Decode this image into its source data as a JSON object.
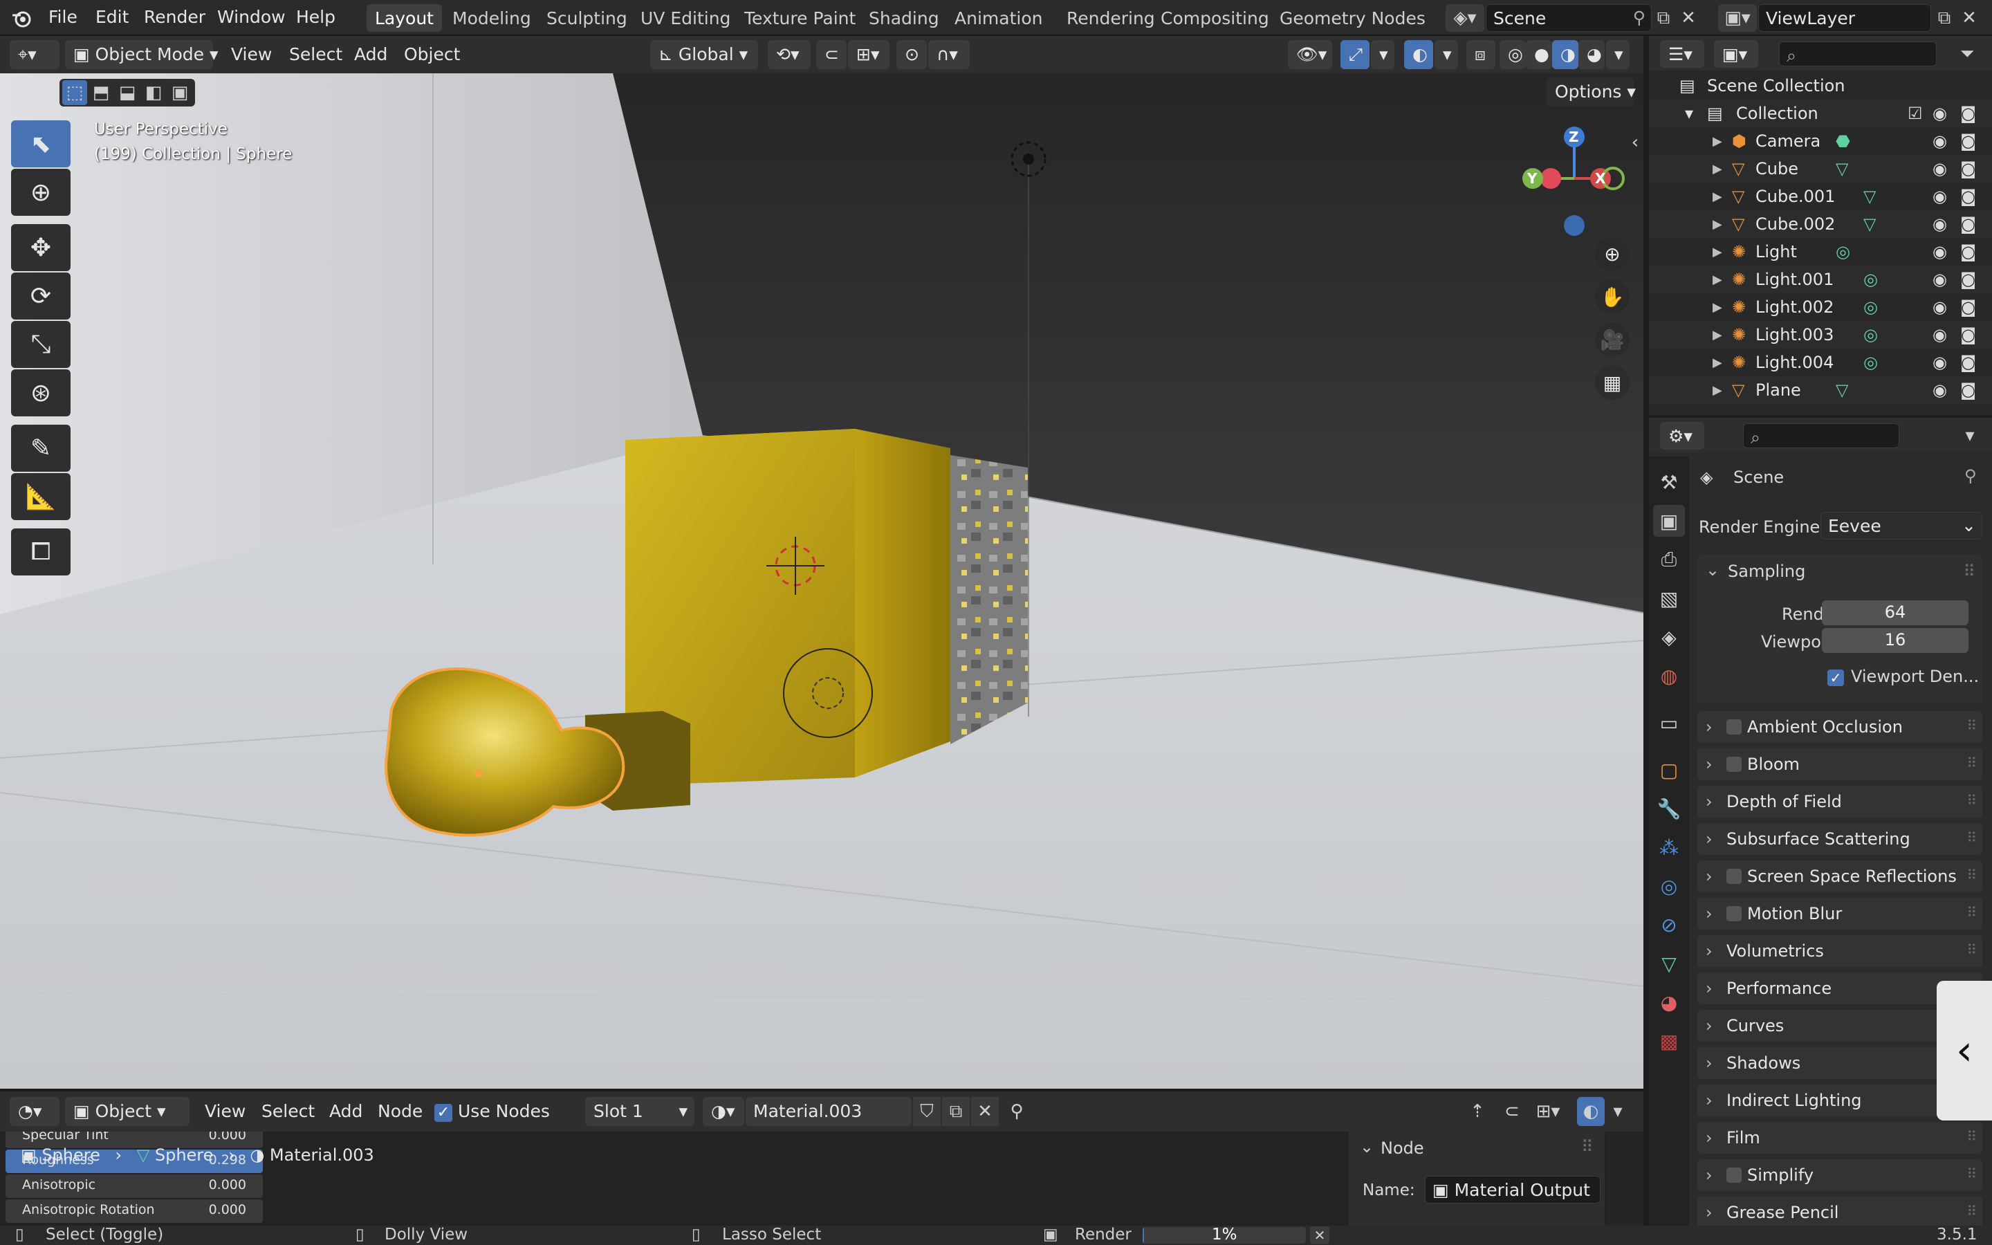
{
  "app": {
    "menus": [
      "File",
      "Edit",
      "Render",
      "Window",
      "Help"
    ],
    "workspace_tabs": [
      "Layout",
      "Modeling",
      "Sculpting",
      "UV Editing",
      "Texture Paint",
      "Shading",
      "Animation",
      "Rendering",
      "Compositing",
      "Geometry Nodes"
    ],
    "active_workspace": "Layout",
    "scene_name": "Scene",
    "view_layer": "ViewLayer"
  },
  "viewport": {
    "mode": "Object Mode",
    "menus": [
      "View",
      "Select",
      "Add",
      "Object"
    ],
    "transform_orientation": "Global",
    "options_label": "Options",
    "overlay_line1": "User Perspective",
    "overlay_line2": "(199) Collection | Sphere",
    "gizmo_axes": {
      "z": "Z",
      "y": "Y",
      "x": "X"
    }
  },
  "outliner": {
    "root": "Scene Collection",
    "collection": "Collection",
    "items": [
      {
        "name": "Camera",
        "type": "camera"
      },
      {
        "name": "Cube",
        "type": "mesh"
      },
      {
        "name": "Cube.001",
        "type": "mesh"
      },
      {
        "name": "Cube.002",
        "type": "mesh"
      },
      {
        "name": "Light",
        "type": "light"
      },
      {
        "name": "Light.001",
        "type": "light"
      },
      {
        "name": "Light.002",
        "type": "light"
      },
      {
        "name": "Light.003",
        "type": "light"
      },
      {
        "name": "Light.004",
        "type": "light"
      },
      {
        "name": "Plane",
        "type": "mesh"
      }
    ]
  },
  "properties": {
    "context": "Scene",
    "render_engine_label": "Render Engine",
    "render_engine": "Eevee",
    "sampling": {
      "label": "Sampling",
      "render_label": "Render",
      "render_value": "64",
      "viewport_label": "Viewport",
      "viewport_value": "16",
      "denoise_label": "Viewport Den..."
    },
    "panels": [
      {
        "label": "Ambient Occlusion",
        "checkbox": true
      },
      {
        "label": "Bloom",
        "checkbox": true
      },
      {
        "label": "Depth of Field",
        "checkbox": false
      },
      {
        "label": "Subsurface Scattering",
        "checkbox": false
      },
      {
        "label": "Screen Space Reflections",
        "checkbox": true
      },
      {
        "label": "Motion Blur",
        "checkbox": true
      },
      {
        "label": "Volumetrics",
        "checkbox": false
      },
      {
        "label": "Performance",
        "checkbox": false
      },
      {
        "label": "Curves",
        "checkbox": false
      },
      {
        "label": "Shadows",
        "checkbox": false
      },
      {
        "label": "Indirect Lighting",
        "checkbox": false
      },
      {
        "label": "Film",
        "checkbox": false
      },
      {
        "label": "Simplify",
        "checkbox": true
      },
      {
        "label": "Grease Pencil",
        "checkbox": false
      }
    ]
  },
  "shader_editor": {
    "object_mode": "Object",
    "menus": [
      "View",
      "Select",
      "Add",
      "Node"
    ],
    "use_nodes_label": "Use Nodes",
    "slot": "Slot 1",
    "material": "Material.003",
    "breadcrumb": [
      "Sphere",
      "Sphere",
      "Material.003"
    ],
    "mini_rows": [
      {
        "label": "Specular Tint",
        "value": "0.000"
      },
      {
        "label": "Roughness",
        "value": "0.298"
      },
      {
        "label": "Anisotropic",
        "value": "0.000"
      },
      {
        "label": "Anisotropic Rotation",
        "value": "0.000"
      }
    ],
    "node_panel_title": "Node",
    "node_name_label": "Name:",
    "node_name": "Material Output"
  },
  "status": {
    "select": "Select (Toggle)",
    "dolly": "Dolly View",
    "lasso": "Lasso Select",
    "render_label": "Render",
    "render_progress": "1%",
    "render_progress_fraction": 0.01,
    "version": "3.5.1"
  },
  "colors": {
    "accent": "#4772b3",
    "selection_outline": "#f5a340",
    "gold": "#c9a618"
  }
}
